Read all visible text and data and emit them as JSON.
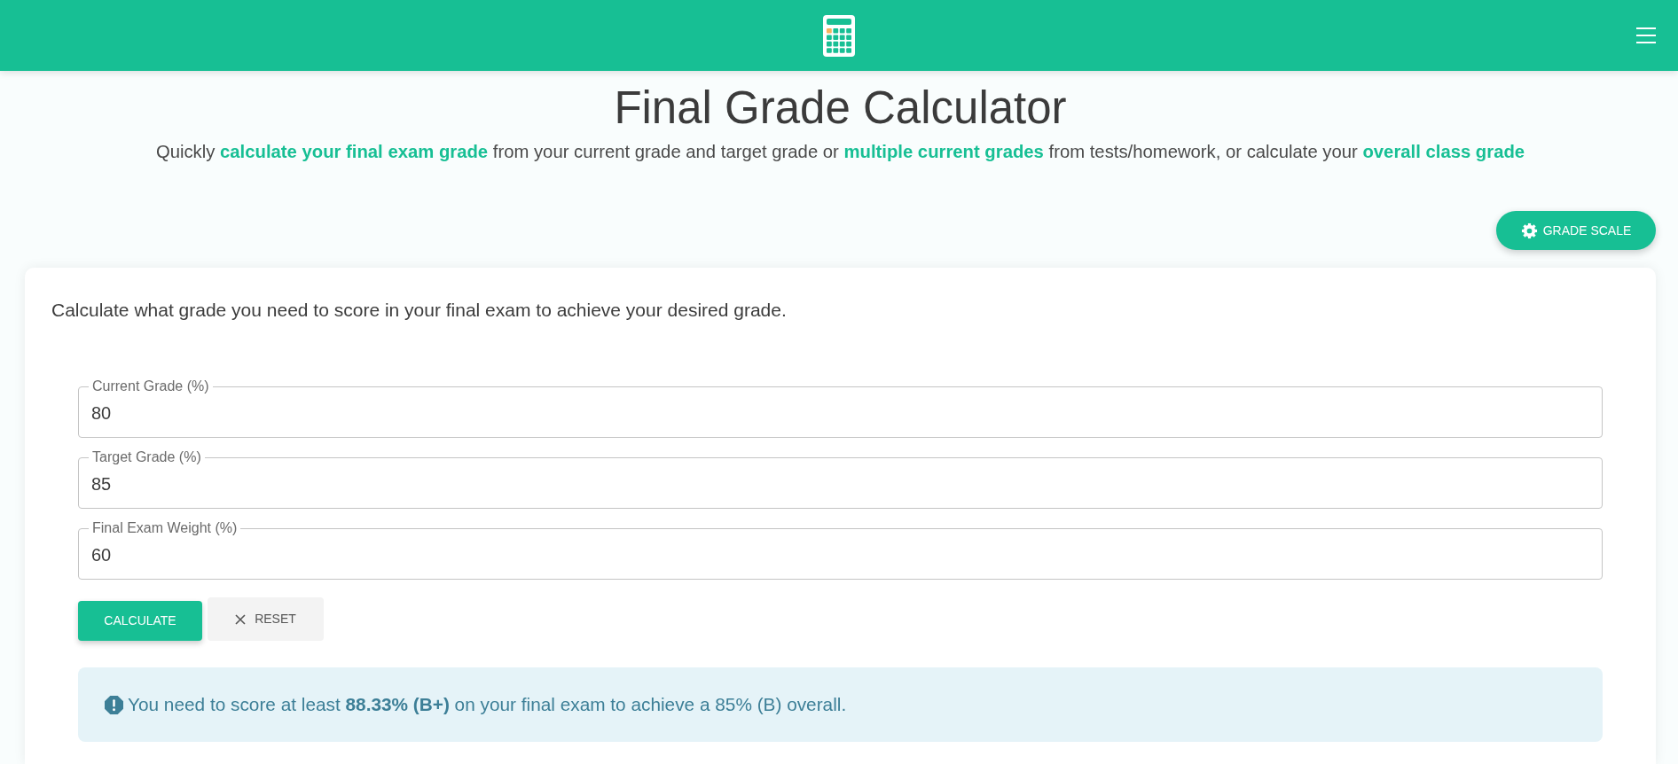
{
  "title": "Final Grade Calculator",
  "subtitle": [
    {
      "kind": "text",
      "text": "Quickly"
    },
    {
      "kind": "link",
      "text": "calculate your final exam grade"
    },
    {
      "kind": "text",
      "text": "from your current grade and target grade or"
    },
    {
      "kind": "link",
      "text": "multiple current grades"
    },
    {
      "kind": "text",
      "text": "from tests/homework, or calculate your"
    },
    {
      "kind": "link",
      "text": "overall class grade"
    }
  ],
  "grade_scale_button": {
    "label": "GRADE SCALE"
  },
  "card": {
    "description": "Calculate what grade you need to score in your final exam to achieve your desired grade.",
    "fields": [
      {
        "label": "Current Grade (%)",
        "value": "80"
      },
      {
        "label": "Target Grade (%)",
        "value": "85"
      },
      {
        "label": "Final Exam Weight (%)",
        "value": "60"
      }
    ],
    "buttons": [
      {
        "kind": "primary",
        "label": "CALCULATE"
      },
      {
        "kind": "reset",
        "label": "RESET"
      }
    ],
    "result": "You need to score at least **88.33% (B+)** on your final exam to achieve a 85% (B) overall."
  }
}
